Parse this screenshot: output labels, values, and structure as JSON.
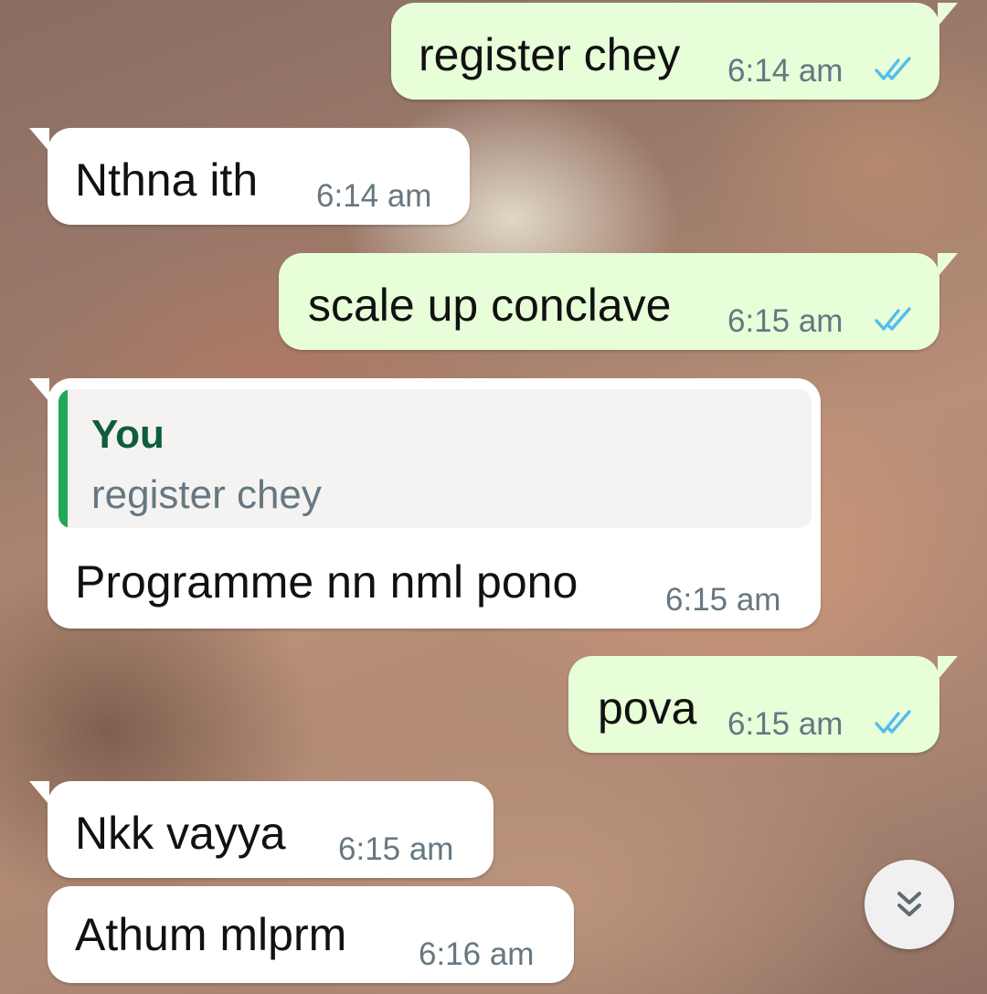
{
  "chat": {
    "messages": [
      {
        "id": 1,
        "direction": "outgoing",
        "text": "register chey",
        "time": "6:14 am",
        "status": "read"
      },
      {
        "id": 2,
        "direction": "incoming",
        "text": "Nthna ith",
        "time": "6:14 am"
      },
      {
        "id": 3,
        "direction": "outgoing",
        "text": "scale up conclave",
        "time": "6:15 am",
        "status": "read"
      },
      {
        "id": 4,
        "direction": "incoming",
        "reply_to": {
          "author": "You",
          "text": "register chey"
        },
        "text": "Programme nn nml pono",
        "time": "6:15 am"
      },
      {
        "id": 5,
        "direction": "outgoing",
        "text": "pova",
        "time": "6:15 am",
        "status": "read"
      },
      {
        "id": 6,
        "direction": "incoming",
        "text": "Nkk vayya",
        "time": "6:15 am"
      },
      {
        "id": 7,
        "direction": "incoming",
        "text": "Athum mlprm",
        "time": "6:16 am"
      }
    ]
  },
  "scroll_button": {
    "icon": "double-chevron-down-icon"
  },
  "colors": {
    "outgoing_bubble": "#e7fed9",
    "incoming_bubble": "#ffffff",
    "read_ticks": "#53bdeb",
    "timestamp": "#667781",
    "quote_bar": "#1fa855",
    "quote_author": "#0f5d3c"
  }
}
